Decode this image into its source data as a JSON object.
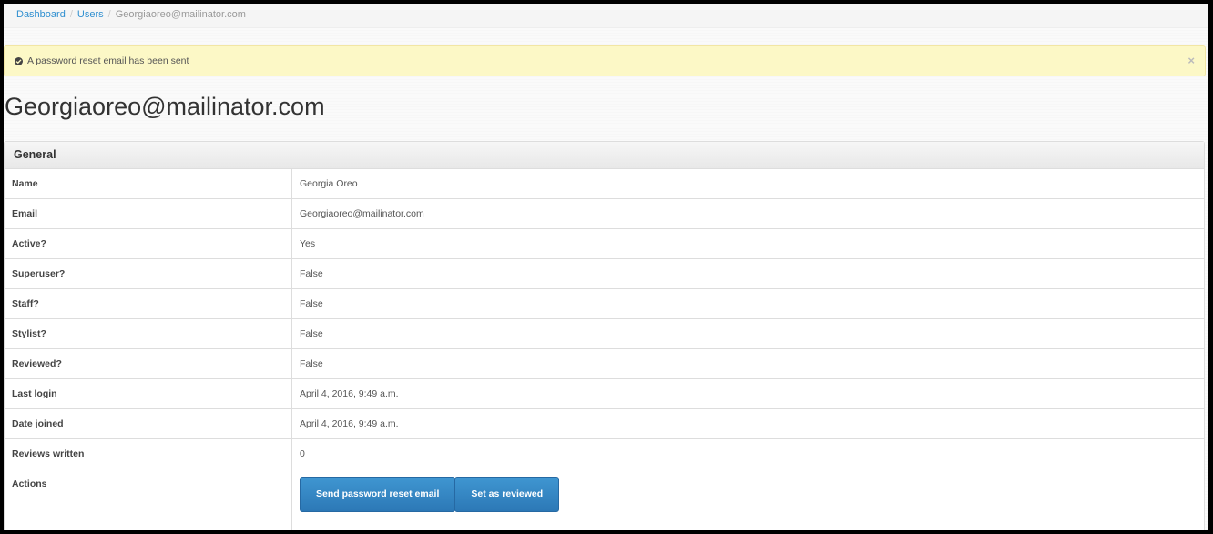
{
  "breadcrumb": {
    "items": [
      "Dashboard",
      "Users"
    ],
    "current": "Georgiaoreo@mailinator.com"
  },
  "alert": {
    "message": "A password reset email has been sent",
    "close": "×",
    "icon": "check-circle-icon"
  },
  "page_title": "Georgiaoreo@mailinator.com",
  "panel": {
    "heading": "General",
    "rows": [
      {
        "label": "Name",
        "value": "Georgia Oreo"
      },
      {
        "label": "Email",
        "value": "Georgiaoreo@mailinator.com"
      },
      {
        "label": "Active?",
        "value": "Yes"
      },
      {
        "label": "Superuser?",
        "value": "False"
      },
      {
        "label": "Staff?",
        "value": "False"
      },
      {
        "label": "Stylist?",
        "value": "False"
      },
      {
        "label": "Reviewed?",
        "value": "False"
      },
      {
        "label": "Last login",
        "value": "April 4, 2016, 9:49 a.m."
      },
      {
        "label": "Date joined",
        "value": "April 4, 2016, 9:49 a.m."
      },
      {
        "label": "Reviews written",
        "value": "0"
      }
    ],
    "actions_label": "Actions",
    "buttons": [
      "Send password reset email",
      "Set as reviewed"
    ]
  },
  "colors": {
    "link": "#2f8fd0",
    "alert_bg": "#fcf8c6",
    "button": "#2c78b6"
  }
}
